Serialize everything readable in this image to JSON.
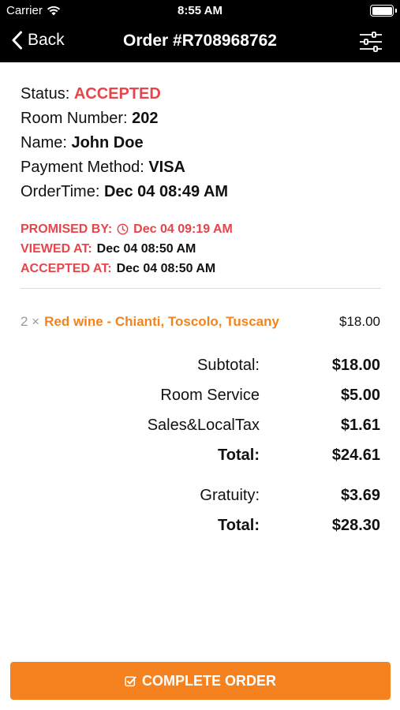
{
  "status_bar": {
    "carrier": "Carrier",
    "time": "8:55 AM"
  },
  "nav": {
    "back_label": "Back",
    "title": "Order #R708968762"
  },
  "order": {
    "status_label": "Status: ",
    "status_value": "ACCEPTED",
    "room_label": "Room Number: ",
    "room_value": "202",
    "name_label": "Name: ",
    "name_value": "John Doe",
    "payment_label": "Payment Method: ",
    "payment_value": "VISA",
    "ordertime_label": "OrderTime: ",
    "ordertime_value": "Dec 04 08:49 AM"
  },
  "timeline": {
    "promised_label": "PROMISED BY:",
    "promised_value": "Dec 04 09:19 AM",
    "viewed_label": "VIEWED AT:",
    "viewed_value": "Dec 04 08:50 AM",
    "accepted_label": "ACCEPTED AT:",
    "accepted_value": "Dec 04 08:50 AM"
  },
  "items": [
    {
      "qty": "2 ×",
      "name": "Red wine - Chianti, Toscolo, Tuscany",
      "price": "$18.00"
    }
  ],
  "summary": {
    "subtotal_label": "Subtotal:",
    "subtotal_value": "$18.00",
    "room_service_label": "Room Service",
    "room_service_value": "$5.00",
    "tax_label": "Sales&LocalTax",
    "tax_value": "$1.61",
    "total_label": "Total:",
    "total_value": "$24.61",
    "gratuity_label": "Gratuity:",
    "gratuity_value": "$3.69",
    "grand_total_label": "Total:",
    "grand_total_value": "$28.30"
  },
  "actions": {
    "complete_label": "COMPLETE ORDER"
  },
  "colors": {
    "accent_red": "#e8444a",
    "accent_orange": "#f0841f",
    "button_orange": "#f5821f",
    "nav_bg": "#000000"
  },
  "icons": {
    "back": "chevron-left-icon",
    "filter": "sliders-icon",
    "promised": "clock-icon",
    "complete": "check-square-icon",
    "wifi": "wifi-icon",
    "battery": "battery-icon"
  }
}
